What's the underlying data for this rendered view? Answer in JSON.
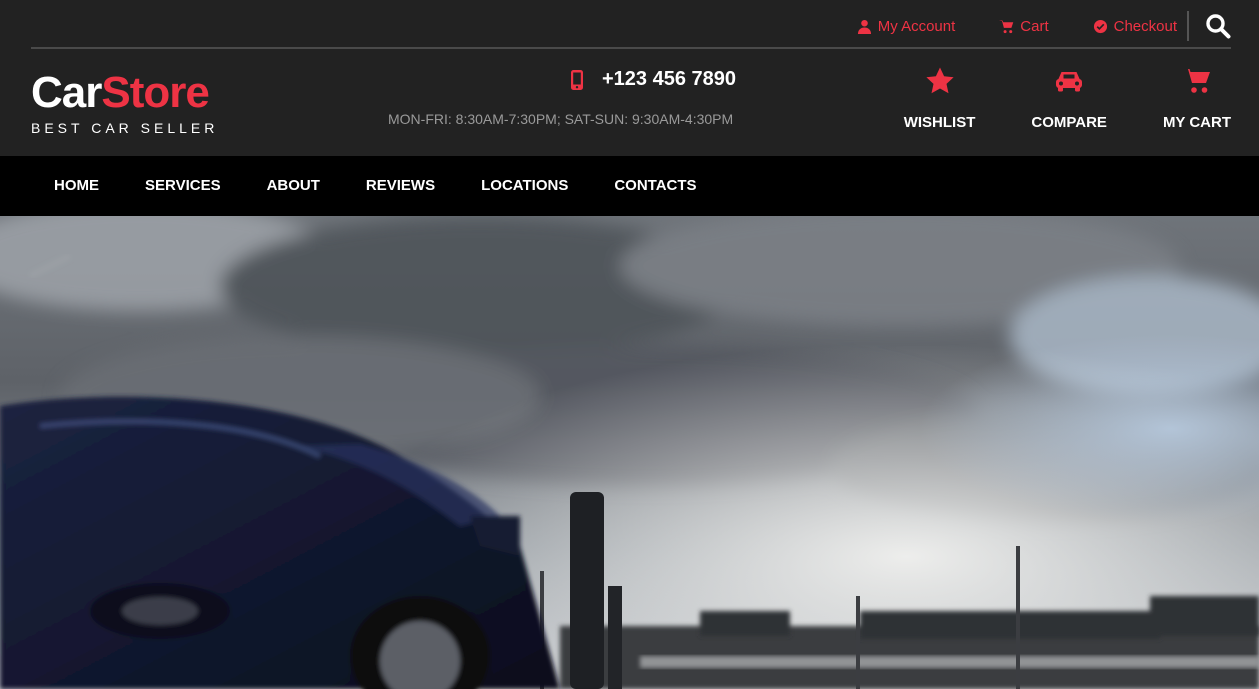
{
  "top_links": {
    "account": "My Account",
    "cart": "Cart",
    "checkout": "Checkout"
  },
  "logo": {
    "part1": "Car",
    "part2": "Store",
    "tagline": "BEST CAR SELLER"
  },
  "contact": {
    "phone": "+123 456 7890",
    "hours": "MON-FRI: 8:30AM-7:30PM; SAT-SUN: 9:30AM-4:30PM"
  },
  "actions": {
    "wishlist": "WISHLIST",
    "compare": "COMPARE",
    "cart": "MY CART"
  },
  "nav": {
    "home": "HOME",
    "services": "SERVICES",
    "about": "ABOUT",
    "reviews": "REVIEWS",
    "locations": "LOCATIONS",
    "contacts": "CONTACTS"
  },
  "colors": {
    "accent": "#ee3344",
    "topbar": "#222222",
    "nav": "#000000"
  },
  "icons": {
    "account": "user-icon",
    "cart": "cart-icon",
    "checkout": "check-circle-icon",
    "search": "search-icon",
    "phone": "mobile-phone-icon",
    "wishlist": "star-icon",
    "compare": "car-icon",
    "my_cart": "shopping-cart-icon"
  }
}
